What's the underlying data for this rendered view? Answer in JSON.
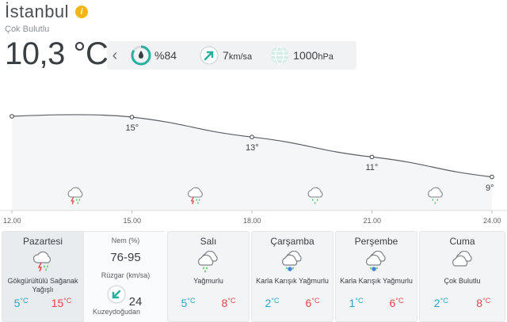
{
  "header": {
    "city": "İstanbul",
    "badge": "i",
    "condition": "Çok Bulutlu",
    "temperature": "10,3 °C"
  },
  "stats": {
    "humidity": "%84",
    "wind_value": "7",
    "wind_unit": "km/sa",
    "pressure_value": "1000",
    "pressure_unit": "hPa"
  },
  "chart_data": {
    "type": "line",
    "x": [
      "12.00",
      "15.00",
      "18.00",
      "21.00",
      "24.00"
    ],
    "series": [
      {
        "values": [
          15,
          15,
          13,
          11,
          9
        ]
      }
    ],
    "point_labels": [
      "",
      "15°",
      "13°",
      "11°",
      "9°"
    ],
    "icons": [
      "thunderstorm-rain",
      "thunderstorm-rain",
      "rain",
      "rain"
    ]
  },
  "forecast": {
    "days": [
      {
        "name": "Pazartesi",
        "desc_line1": "Gökgürültülü Sağanak",
        "desc_line2": "Yağışlı",
        "lo": "5",
        "hi": "15"
      },
      {
        "name": "Salı",
        "desc_line1": "Yağmurlu",
        "desc_line2": "",
        "lo": "5",
        "hi": "8"
      },
      {
        "name": "Çarşamba",
        "desc_line1": "Karla Karışık Yağmurlu",
        "desc_line2": "",
        "lo": "2",
        "hi": "6"
      },
      {
        "name": "Perşembe",
        "desc_line1": "Karla Karışık Yağmurlu",
        "desc_line2": "",
        "lo": "1",
        "hi": "6"
      },
      {
        "name": "Cuma",
        "desc_line1": "Çok Bulutlu",
        "desc_line2": "",
        "lo": "2",
        "hi": "8"
      }
    ],
    "unit": "°C",
    "detail": {
      "humidity_label": "Nem (%)",
      "humidity_value": "76-95",
      "wind_label": "Rüzgar (km/sa)",
      "wind_dir": "Kuzeydoğudan",
      "wind_value": "24"
    }
  },
  "colors": {
    "humidity_ring": "#27b0a0",
    "wind_arrow": "#27b0a0",
    "low_temp": "#2ba5c4",
    "high_temp": "#e3474a",
    "badge": "#f5b50e"
  }
}
